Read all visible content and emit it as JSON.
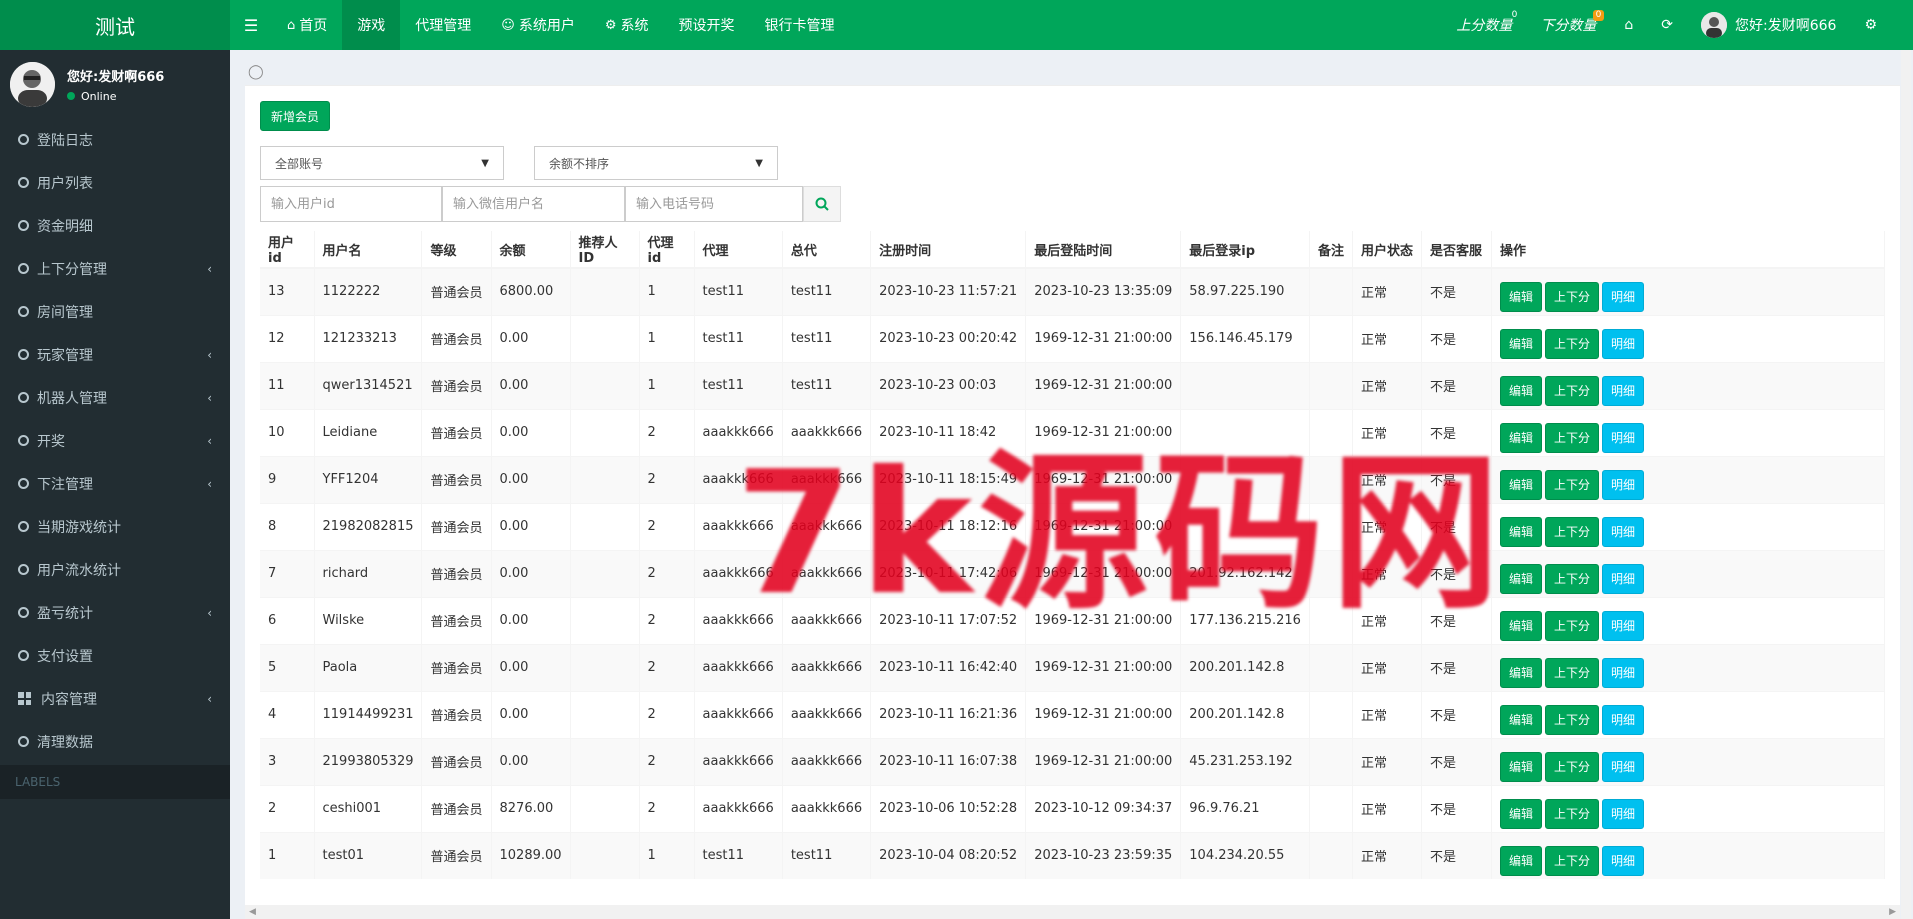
{
  "app": {
    "logo_text": "测试"
  },
  "header": {
    "nav": [
      {
        "label": "首页",
        "icon": "home-icon",
        "active": false
      },
      {
        "label": "游戏",
        "icon": "",
        "active": true
      },
      {
        "label": "代理管理",
        "icon": "",
        "active": false
      },
      {
        "label": "系统用户",
        "icon": "user-icon",
        "active": false
      },
      {
        "label": "系统",
        "icon": "gear-icon",
        "active": false
      },
      {
        "label": "预设开奖",
        "icon": "",
        "active": false
      },
      {
        "label": "银行卡管理",
        "icon": "",
        "active": false
      }
    ],
    "up_score_label": "上分数量",
    "up_score_count": "0",
    "down_score_label": "下分数量",
    "down_score_count": "0",
    "greeting": "您好:发财啊666"
  },
  "sidebar": {
    "user_name": "您好:发财啊666",
    "status": "Online",
    "items": [
      {
        "label": "登陆日志",
        "icon": "circle-icon",
        "has_children": false
      },
      {
        "label": "用户列表",
        "icon": "circle-icon",
        "has_children": false
      },
      {
        "label": "资金明细",
        "icon": "circle-icon",
        "has_children": false
      },
      {
        "label": "上下分管理",
        "icon": "circle-icon",
        "has_children": true
      },
      {
        "label": "房间管理",
        "icon": "circle-icon",
        "has_children": false
      },
      {
        "label": "玩家管理",
        "icon": "circle-icon",
        "has_children": true
      },
      {
        "label": "机器人管理",
        "icon": "circle-icon",
        "has_children": true
      },
      {
        "label": "开奖",
        "icon": "circle-icon",
        "has_children": true
      },
      {
        "label": "下注管理",
        "icon": "circle-icon",
        "has_children": true
      },
      {
        "label": "当期游戏统计",
        "icon": "circle-icon",
        "has_children": false
      },
      {
        "label": "用户流水统计",
        "icon": "circle-icon",
        "has_children": false
      },
      {
        "label": "盈亏统计",
        "icon": "circle-icon",
        "has_children": true
      },
      {
        "label": "支付设置",
        "icon": "circle-icon",
        "has_children": false
      },
      {
        "label": "内容管理",
        "icon": "grid-icon",
        "has_children": true
      },
      {
        "label": "清理数据",
        "icon": "circle-icon",
        "has_children": false
      }
    ],
    "labels_header": "LABELS"
  },
  "main": {
    "add_button": "新增会员",
    "filter_account": "全部账号",
    "filter_sort": "余额不排序",
    "search_userid_placeholder": "输入用户id",
    "search_wechat_placeholder": "输入微信用户名",
    "search_phone_placeholder": "输入电话号码",
    "columns": [
      "用户id",
      "用户名",
      "等级",
      "余额",
      "推荐人ID",
      "代理id",
      "代理",
      "总代",
      "注册时间",
      "最后登陆时间",
      "最后登录ip",
      "备注",
      "用户状态",
      "是否客服",
      "操作"
    ],
    "action_labels": {
      "edit": "编辑",
      "score": "上下分",
      "detail": "明细"
    },
    "rows": [
      [
        "13",
        "1122222",
        "普通会员",
        "6800.00",
        "",
        "1",
        "test11",
        "test11",
        "2023-10-23 11:57:21",
        "2023-10-23 13:35:09",
        "58.97.225.190",
        "",
        "正常",
        "不是"
      ],
      [
        "12",
        "121233213",
        "普通会员",
        "0.00",
        "",
        "1",
        "test11",
        "test11",
        "2023-10-23 00:20:42",
        "1969-12-31 21:00:00",
        "156.146.45.179",
        "",
        "正常",
        "不是"
      ],
      [
        "11",
        "qwer1314521",
        "普通会员",
        "0.00",
        "",
        "1",
        "test11",
        "test11",
        "2023-10-23 00:03",
        "1969-12-31 21:00:00",
        "",
        "",
        "正常",
        "不是"
      ],
      [
        "10",
        "Leidiane",
        "普通会员",
        "0.00",
        "",
        "2",
        "aaakkk666",
        "aaakkk666",
        "2023-10-11 18:42",
        "1969-12-31 21:00:00",
        "",
        "",
        "正常",
        "不是"
      ],
      [
        "9",
        "YFF1204",
        "普通会员",
        "0.00",
        "",
        "2",
        "aaakkk666",
        "aaakkk666",
        "2023-10-11 18:15:49",
        "1969-12-31 21:00:00",
        "",
        "",
        "正常",
        "不是"
      ],
      [
        "8",
        "21982082815",
        "普通会员",
        "0.00",
        "",
        "2",
        "aaakkk666",
        "aaakkk666",
        "2023-10-11 18:12:16",
        "1969-12-31 21:00:00",
        "",
        "",
        "正常",
        "不是"
      ],
      [
        "7",
        "richard",
        "普通会员",
        "0.00",
        "",
        "2",
        "aaakkk666",
        "aaakkk666",
        "2023-10-11 17:42:06",
        "1969-12-31 21:00:00",
        "201.92.162.142",
        "",
        "正常",
        "不是"
      ],
      [
        "6",
        "Wilske",
        "普通会员",
        "0.00",
        "",
        "2",
        "aaakkk666",
        "aaakkk666",
        "2023-10-11 17:07:52",
        "1969-12-31 21:00:00",
        "177.136.215.216",
        "",
        "正常",
        "不是"
      ],
      [
        "5",
        "Paola",
        "普通会员",
        "0.00",
        "",
        "2",
        "aaakkk666",
        "aaakkk666",
        "2023-10-11 16:42:40",
        "1969-12-31 21:00:00",
        "200.201.142.8",
        "",
        "正常",
        "不是"
      ],
      [
        "4",
        "11914499231",
        "普通会员",
        "0.00",
        "",
        "2",
        "aaakkk666",
        "aaakkk666",
        "2023-10-11 16:21:36",
        "1969-12-31 21:00:00",
        "200.201.142.8",
        "",
        "正常",
        "不是"
      ],
      [
        "3",
        "21993805329",
        "普通会员",
        "0.00",
        "",
        "2",
        "aaakkk666",
        "aaakkk666",
        "2023-10-11 16:07:38",
        "1969-12-31 21:00:00",
        "45.231.253.192",
        "",
        "正常",
        "不是"
      ],
      [
        "2",
        "ceshi001",
        "普通会员",
        "8276.00",
        "",
        "2",
        "aaakkk666",
        "aaakkk666",
        "2023-10-06 10:52:28",
        "2023-10-12 09:34:37",
        "96.9.76.21",
        "",
        "正常",
        "不是"
      ],
      [
        "1",
        "test01",
        "普通会员",
        "10289.00",
        "",
        "1",
        "test11",
        "test11",
        "2023-10-04 08:20:52",
        "2023-10-23 23:59:35",
        "104.234.20.55",
        "",
        "正常",
        "不是"
      ]
    ]
  },
  "watermark": "7k源码网",
  "colors": {
    "primary": "#00a65a",
    "primary_dark": "#008d4c",
    "info": "#00c0ef",
    "sidebar_bg": "#222d32",
    "watermark": "#e1001e"
  }
}
